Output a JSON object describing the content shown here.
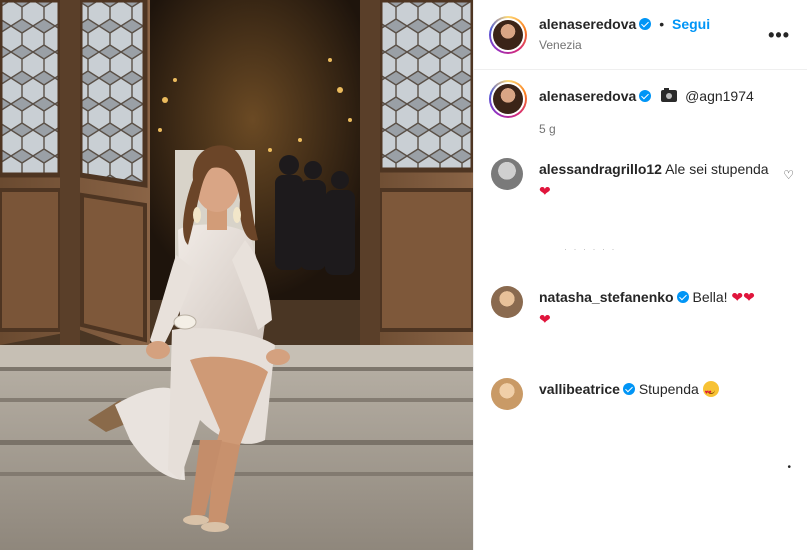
{
  "post": {
    "author": "alenaseredova",
    "follow_label": "Segui",
    "separator": "•",
    "location": "Venezia",
    "more_label": "•••",
    "caption_mention": "@agn1974",
    "time_ago": "5 g"
  },
  "comments": [
    {
      "user": "alessandragrillo12",
      "verified": false,
      "text": "Ale sei stupenda",
      "emoji": "heart"
    },
    {
      "user": "natasha_stefanenko",
      "verified": true,
      "text": "Bella!",
      "emoji": "hearts3"
    },
    {
      "user": "vallibeatrice",
      "verified": true,
      "text": "Stupenda",
      "emoji": "smiling-face-with-hearts"
    }
  ],
  "icons": {
    "heart_outline": "♡",
    "heart_red": "❤"
  },
  "colors": {
    "link_blue": "#0095f6",
    "verified_blue": "#0095f6",
    "heart_red": "#e0153c",
    "muted_text": "#737373"
  }
}
